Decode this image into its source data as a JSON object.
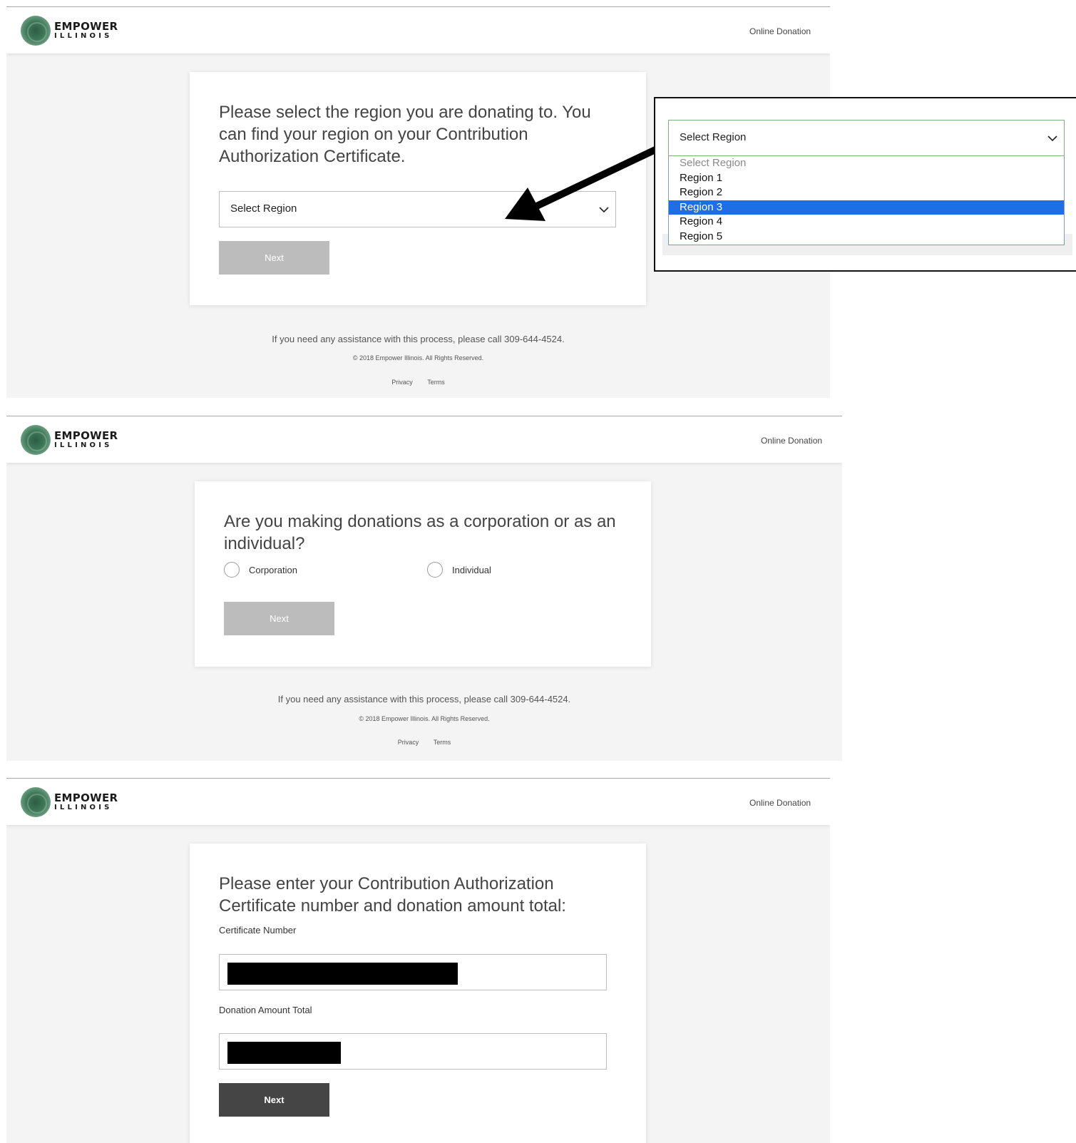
{
  "brand": {
    "name_line1": "EMPOWER",
    "name_line2": "ILLINOIS",
    "nav_link": "Online Donation"
  },
  "footer": {
    "assist_text": "If you need any assistance with this process, please call 309-644-4524.",
    "copyright": "© 2018 Empower Illinois. All Rights Reserved.",
    "privacy": "Privacy",
    "terms": "Terms"
  },
  "step_region": {
    "heading": "Please select the region you are donating to. You can find your region on your Contribution Authorization Certificate.",
    "select_value": "Select Region",
    "next_label": "Next"
  },
  "region_dropdown": {
    "select_value": "Select Region",
    "options": [
      "Select Region",
      "Region 1",
      "Region 2",
      "Region 3",
      "Region 4",
      "Region 5"
    ],
    "highlighted_option": "Region 3"
  },
  "step_donor_type": {
    "heading": "Are you making donations as a corporation or as an individual?",
    "option_corporation": "Corporation",
    "option_individual": "Individual",
    "next_label": "Next"
  },
  "step_certificate": {
    "heading": "Please enter your Contribution Authorization Certificate number and donation amount total:",
    "certificate_label": "Certificate Number",
    "amount_label": "Donation Amount Total",
    "next_label": "Next"
  },
  "colors": {
    "panel_bg": "#f4f4f4",
    "disabled_button": "#bcbcbc",
    "active_button": "#454545",
    "highlight": "#1e6ee8",
    "logo_green": "#3f7a5a"
  }
}
